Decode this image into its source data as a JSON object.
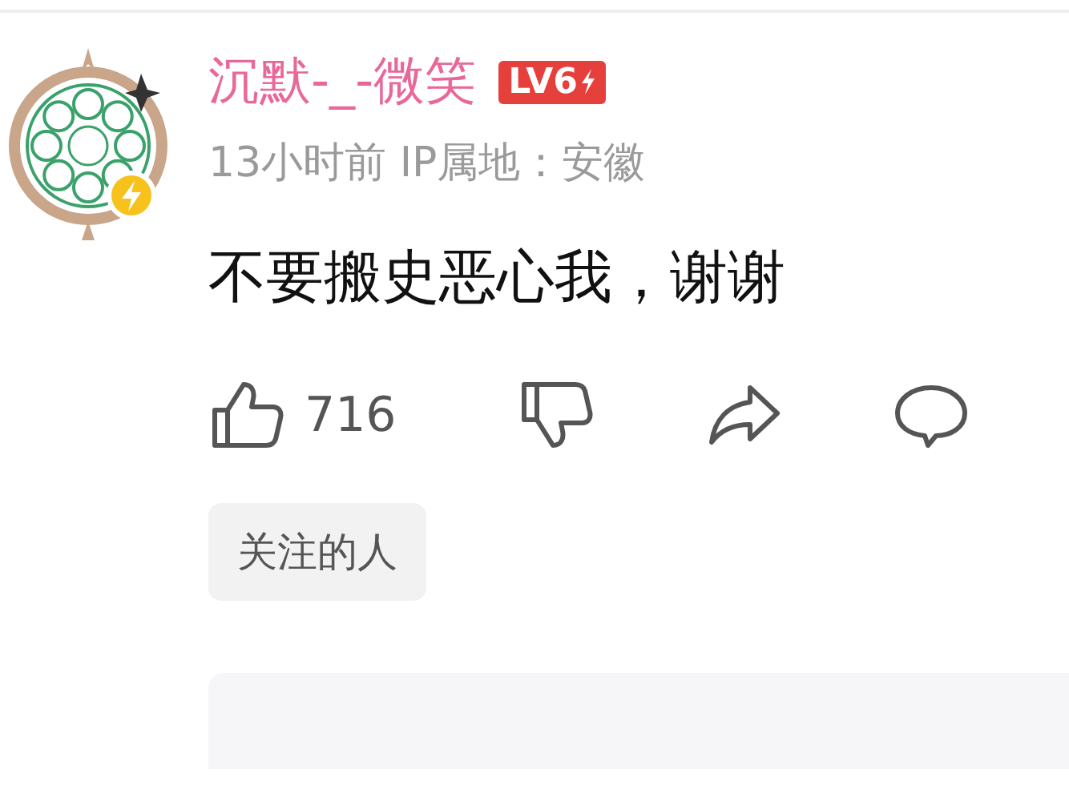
{
  "comment": {
    "username": "沉默-_-微笑",
    "level_badge": "LV6",
    "meta": "13小时前 IP属地：安徽",
    "text": "不要搬史恶心我，谢谢",
    "actions": [
      {
        "kind": "like",
        "count": "716"
      },
      {
        "kind": "dislike"
      },
      {
        "kind": "share"
      },
      {
        "kind": "reply"
      }
    ],
    "tag": "关注的人"
  }
}
